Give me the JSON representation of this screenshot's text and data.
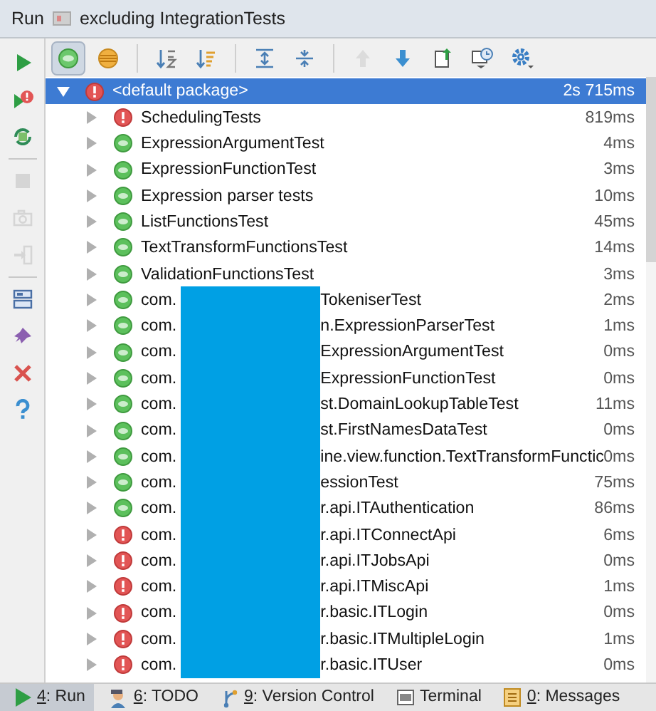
{
  "window": {
    "label": "Run",
    "title": "excluding IntegrationTests"
  },
  "left_toolbar": [
    {
      "kind": "run"
    },
    {
      "kind": "rerun_failed"
    },
    {
      "kind": "toggle_auto"
    },
    {
      "kind": "stop",
      "disabled": true
    },
    {
      "kind": "camera",
      "disabled": true
    },
    {
      "kind": "exit",
      "disabled": true
    },
    {
      "kind": "layout"
    },
    {
      "kind": "pin"
    },
    {
      "kind": "close"
    },
    {
      "kind": "help"
    }
  ],
  "toolbar": [
    {
      "kind": "show_passed",
      "selected": true
    },
    {
      "kind": "show_ignored",
      "selected": false
    },
    {
      "kind": "sort_alpha",
      "selected": false
    },
    {
      "kind": "sort_duration",
      "selected": false
    },
    {
      "kind": "expand_all",
      "selected": false
    },
    {
      "kind": "collapse_all",
      "selected": false
    },
    {
      "kind": "prev",
      "selected": false,
      "disabled": true
    },
    {
      "kind": "next",
      "selected": false
    },
    {
      "kind": "export",
      "selected": false
    },
    {
      "kind": "history",
      "selected": false
    },
    {
      "kind": "settings",
      "selected": false
    }
  ],
  "tree": {
    "name": "<default package>",
    "kind": "failed",
    "time": "2s 715ms",
    "expanded": true,
    "selected": true,
    "children": [
      {
        "name": "SchedulingTests",
        "kind": "failed",
        "time": "819ms"
      },
      {
        "name": "ExpressionArgumentTest",
        "kind": "passed",
        "time": "4ms"
      },
      {
        "name": "ExpressionFunctionTest",
        "kind": "passed",
        "time": "3ms"
      },
      {
        "name": "Expression parser tests",
        "kind": "passed",
        "time": "10ms"
      },
      {
        "name": "ListFunctionsTest",
        "kind": "passed",
        "time": "45ms"
      },
      {
        "name": "TextTransformFunctionsTest",
        "kind": "passed",
        "time": "14ms"
      },
      {
        "name": "ValidationFunctionsTest",
        "kind": "passed",
        "time": "3ms"
      },
      {
        "name": "com.",
        "redacted": true,
        "rest": "TokeniserTest",
        "kind": "passed",
        "time": "2ms"
      },
      {
        "name": "com.",
        "redacted": true,
        "rest": "n.ExpressionParserTest",
        "kind": "passed",
        "time": "1ms"
      },
      {
        "name": "com.",
        "redacted": true,
        "rest": "ExpressionArgumentTest",
        "kind": "passed",
        "time": "0ms"
      },
      {
        "name": "com.",
        "redacted": true,
        "rest": "ExpressionFunctionTest",
        "kind": "passed",
        "time": "0ms"
      },
      {
        "name": "com.",
        "redacted": true,
        "rest": "st.DomainLookupTableTest",
        "kind": "passed",
        "time": "11ms"
      },
      {
        "name": "com.",
        "redacted": true,
        "rest": "st.FirstNamesDataTest",
        "kind": "passed",
        "time": "0ms"
      },
      {
        "name": "com.",
        "redacted": true,
        "rest": "ine.view.function.TextTransformFunctic",
        "kind": "passed",
        "time": "0ms"
      },
      {
        "name": "com.",
        "redacted": true,
        "rest": "essionTest",
        "kind": "passed",
        "time": "75ms"
      },
      {
        "name": "com.",
        "redacted": true,
        "rest": "r.api.ITAuthentication",
        "kind": "passed",
        "time": "86ms"
      },
      {
        "name": "com.",
        "redacted": true,
        "rest": "r.api.ITConnectApi",
        "kind": "failed",
        "time": "6ms"
      },
      {
        "name": "com.",
        "redacted": true,
        "rest": "r.api.ITJobsApi",
        "kind": "failed",
        "time": "0ms"
      },
      {
        "name": "com.",
        "redacted": true,
        "rest": "r.api.ITMiscApi",
        "kind": "failed",
        "time": "1ms"
      },
      {
        "name": "com.",
        "redacted": true,
        "rest": "r.basic.ITLogin",
        "kind": "failed",
        "time": "0ms"
      },
      {
        "name": "com.",
        "redacted": true,
        "rest": "r.basic.ITMultipleLogin",
        "kind": "failed",
        "time": "1ms"
      },
      {
        "name": "com.",
        "redacted": true,
        "rest": "r.basic.ITUser",
        "kind": "failed",
        "time": "0ms"
      }
    ]
  },
  "bottom_tabs": [
    {
      "key": "4",
      "label": ": Run",
      "kind": "run",
      "selected": true
    },
    {
      "key": "6",
      "label": ": TODO",
      "kind": "todo",
      "selected": false
    },
    {
      "key": "9",
      "label": ": Version Control",
      "kind": "vcs",
      "selected": false
    },
    {
      "label": "Terminal",
      "kind": "terminal",
      "selected": false
    },
    {
      "key": "0",
      "label": ": Messages",
      "kind": "messages",
      "selected": false
    }
  ]
}
